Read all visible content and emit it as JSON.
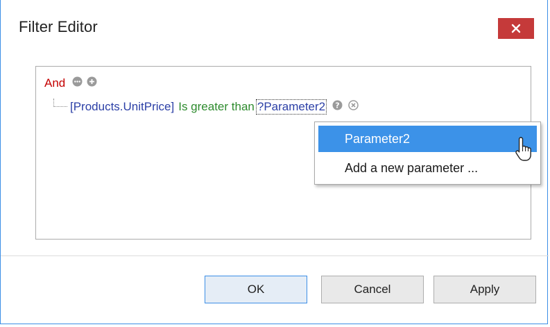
{
  "window": {
    "title": "Filter Editor",
    "close_icon": "close-icon",
    "accent_color": "#c53a3a",
    "border_color": "#3c8ee6"
  },
  "filter": {
    "group_operator": "And",
    "group_icons": [
      "ellipsis-icon",
      "add-icon"
    ],
    "condition": {
      "field": "[Products.UnitPrice]",
      "operator": "Is greater than",
      "value": "?Parameter2",
      "icons": [
        "help-icon",
        "remove-icon"
      ]
    }
  },
  "dropdown": {
    "items": [
      {
        "label": "Parameter2",
        "selected": true
      },
      {
        "label": "Add a new parameter ...",
        "selected": false
      }
    ],
    "selection_color": "#3c92e8"
  },
  "buttons": {
    "ok": "OK",
    "cancel": "Cancel",
    "apply": "Apply"
  }
}
